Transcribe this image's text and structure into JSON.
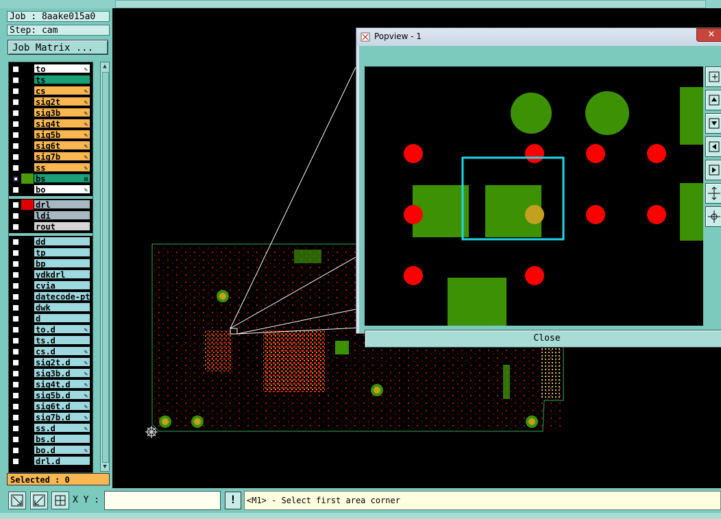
{
  "job_label": "Job : 8aake015a0",
  "step_label": "Step: cam",
  "job_matrix_button": "Job Matrix ...",
  "layers_group1": [
    {
      "name": "to",
      "color": "#ffffff",
      "box": "#000000",
      "edit": "✎"
    },
    {
      "name": "ts",
      "color": "#1aa17a",
      "box": "#000000",
      "edit": ""
    },
    {
      "name": "cs",
      "color": "#f9b751",
      "box": "#000000",
      "edit": "✎"
    },
    {
      "name": "sig2t",
      "color": "#f9b751",
      "box": "#000000",
      "edit": "✎"
    },
    {
      "name": "sig3b",
      "color": "#f9b751",
      "box": "#000000",
      "edit": "✎"
    },
    {
      "name": "sig4t",
      "color": "#f9b751",
      "box": "#000000",
      "edit": "✎"
    },
    {
      "name": "sig5b",
      "color": "#f9b751",
      "box": "#000000",
      "edit": "✎"
    },
    {
      "name": "sig6t",
      "color": "#f9b751",
      "box": "#000000",
      "edit": "✎"
    },
    {
      "name": "sig7b",
      "color": "#f9b751",
      "box": "#000000",
      "edit": "✎"
    },
    {
      "name": "ss",
      "color": "#f9b751",
      "box": "#000000",
      "edit": "✎"
    },
    {
      "name": "bs",
      "color": "#1aa17a",
      "box": "#4a9a0a",
      "edit": "⊞",
      "selected": true
    },
    {
      "name": "bo",
      "color": "#ffffff",
      "box": "#000000",
      "edit": "✎"
    }
  ],
  "layers_group2": [
    {
      "name": "drl",
      "color": "#a6b8c2",
      "box": "#e00000",
      "edit": ""
    },
    {
      "name": "ldi",
      "color": "#a6b8c2",
      "box": "#000000",
      "edit": ""
    },
    {
      "name": "rout",
      "color": "#d4d4d4",
      "box": "#000000",
      "edit": ""
    }
  ],
  "layers_group3": [
    {
      "name": "dd",
      "color": "#9fd9e0",
      "edit": ""
    },
    {
      "name": "tp",
      "color": "#9fd9e0",
      "edit": ""
    },
    {
      "name": "bp",
      "color": "#9fd9e0",
      "edit": ""
    },
    {
      "name": "ydkdrl",
      "color": "#9fd9e0",
      "edit": ""
    },
    {
      "name": "cvia",
      "color": "#9fd9e0",
      "edit": ""
    },
    {
      "name": "datecode-pte",
      "color": "#9fd9e0",
      "edit": ""
    },
    {
      "name": "dwk",
      "color": "#9fd9e0",
      "edit": ""
    },
    {
      "name": "d",
      "color": "#9fd9e0",
      "edit": ""
    },
    {
      "name": "to.d",
      "color": "#9fd9e0",
      "edit": "✎"
    },
    {
      "name": "ts.d",
      "color": "#9fd9e0",
      "edit": ""
    },
    {
      "name": "cs.d",
      "color": "#9fd9e0",
      "edit": "✎"
    },
    {
      "name": "sig2t.d",
      "color": "#9fd9e0",
      "edit": "✎"
    },
    {
      "name": "sig3b.d",
      "color": "#9fd9e0",
      "edit": "✎"
    },
    {
      "name": "sig4t.d",
      "color": "#9fd9e0",
      "edit": "✎"
    },
    {
      "name": "sig5b.d",
      "color": "#9fd9e0",
      "edit": "✎"
    },
    {
      "name": "sig6t.d",
      "color": "#9fd9e0",
      "edit": "✎"
    },
    {
      "name": "sig7b.d",
      "color": "#9fd9e0",
      "edit": "✎"
    },
    {
      "name": "ss.d",
      "color": "#9fd9e0",
      "edit": "✎"
    },
    {
      "name": "bs.d",
      "color": "#9fd9e0",
      "edit": ""
    },
    {
      "name": "bo.d",
      "color": "#9fd9e0",
      "edit": "✎"
    },
    {
      "name": "drl.d",
      "color": "#9fd9e0",
      "edit": ""
    }
  ],
  "selected_label": "Selected : 0",
  "xy_label": "X Y :",
  "xy_value": "",
  "status_message": "<M1> - Select first area corner",
  "popview": {
    "title": "Popview - 1",
    "close_label": "Close",
    "close_x": "✕"
  },
  "colors": {
    "panel": "#7cc9be",
    "pad_green": "#3d9104",
    "drill_red": "#ff0000",
    "highlight": "#20d8e8"
  },
  "icons": [
    "zoom-in-icon",
    "zoom-out-icon",
    "grid-icon",
    "window-icon",
    "pan-up-icon",
    "pan-down-icon",
    "pan-left-icon",
    "pan-right-icon",
    "fit-icon",
    "center-icon",
    "origin-icon"
  ]
}
